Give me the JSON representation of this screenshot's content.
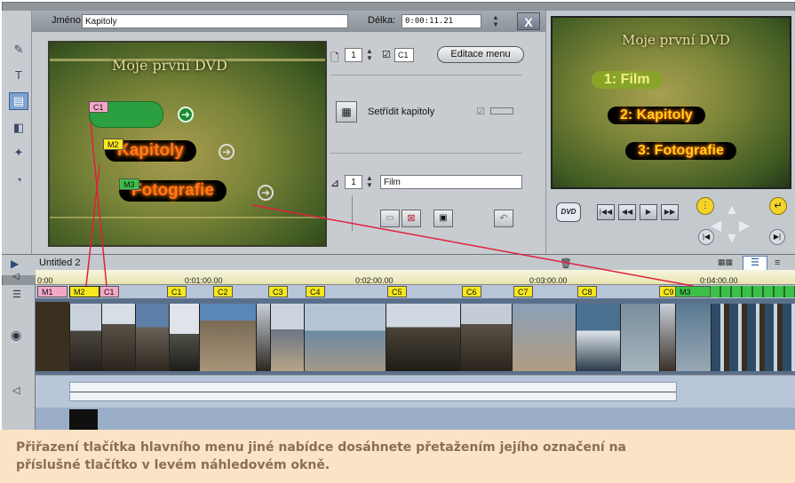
{
  "menu_editor": {
    "name_label": "Jméno:",
    "name_value": "Kapitoly",
    "length_label": "Délka:",
    "length_value": "0:00:11.21",
    "close_label": "X",
    "page_counter": "1",
    "page_spin": "▲▼",
    "chapter_check": "☑",
    "chapter_link": "C1",
    "edit_menu_button": "Editace menu",
    "sort_chapters_label": "Setřídit kapitoly",
    "sort_check": "☑",
    "button_counter": "1",
    "button_spin": "▲▼",
    "button_name_value": "Film"
  },
  "menu_preview": {
    "title": "Moje první DVD",
    "buttons": [
      "Kapitoly",
      "Fotografie"
    ],
    "flags": [
      "C1",
      "M2",
      "M3"
    ]
  },
  "player": {
    "title": "Moje první DVD",
    "buttons": [
      "1: Film",
      "2: Kapitoly",
      "3: Fotografie"
    ],
    "dvd_label": "DVD"
  },
  "timeline": {
    "project_name": "Untitled 2",
    "ruler_ticks": [
      "0:00",
      "0:01:00.00",
      "0:02:00.00",
      "0:03:00.00",
      "0:04:00.00"
    ],
    "markers": [
      {
        "label": "M1",
        "kind": "menu"
      },
      {
        "label": "M2",
        "kind": "menu-active"
      },
      {
        "label": "C1",
        "kind": "chapter-link"
      },
      {
        "label": "C1",
        "kind": "chapter"
      },
      {
        "label": "C2",
        "kind": "chapter"
      },
      {
        "label": "C3",
        "kind": "chapter"
      },
      {
        "label": "C4",
        "kind": "chapter"
      },
      {
        "label": "C5",
        "kind": "chapter"
      },
      {
        "label": "C6",
        "kind": "chapter"
      },
      {
        "label": "C7",
        "kind": "chapter"
      },
      {
        "label": "C8",
        "kind": "chapter"
      },
      {
        "label": "C9",
        "kind": "chapter"
      },
      {
        "label": "M3",
        "kind": "menu-green"
      }
    ]
  },
  "caption": {
    "line1": "Přiřazení tlačítka hlavního menu jiné nabídce dosáhnete přetažením jejího označení na",
    "line2": "příslušné tlačítko v levém náhledovém okně."
  },
  "colors": {
    "frame": "#8e959b",
    "panel": "#c8ccd0",
    "caption_bg": "#fbe3c6",
    "caption_text": "#8a6e57",
    "drag_line": "#e0203c",
    "button_glow": "#ff7a1a"
  }
}
